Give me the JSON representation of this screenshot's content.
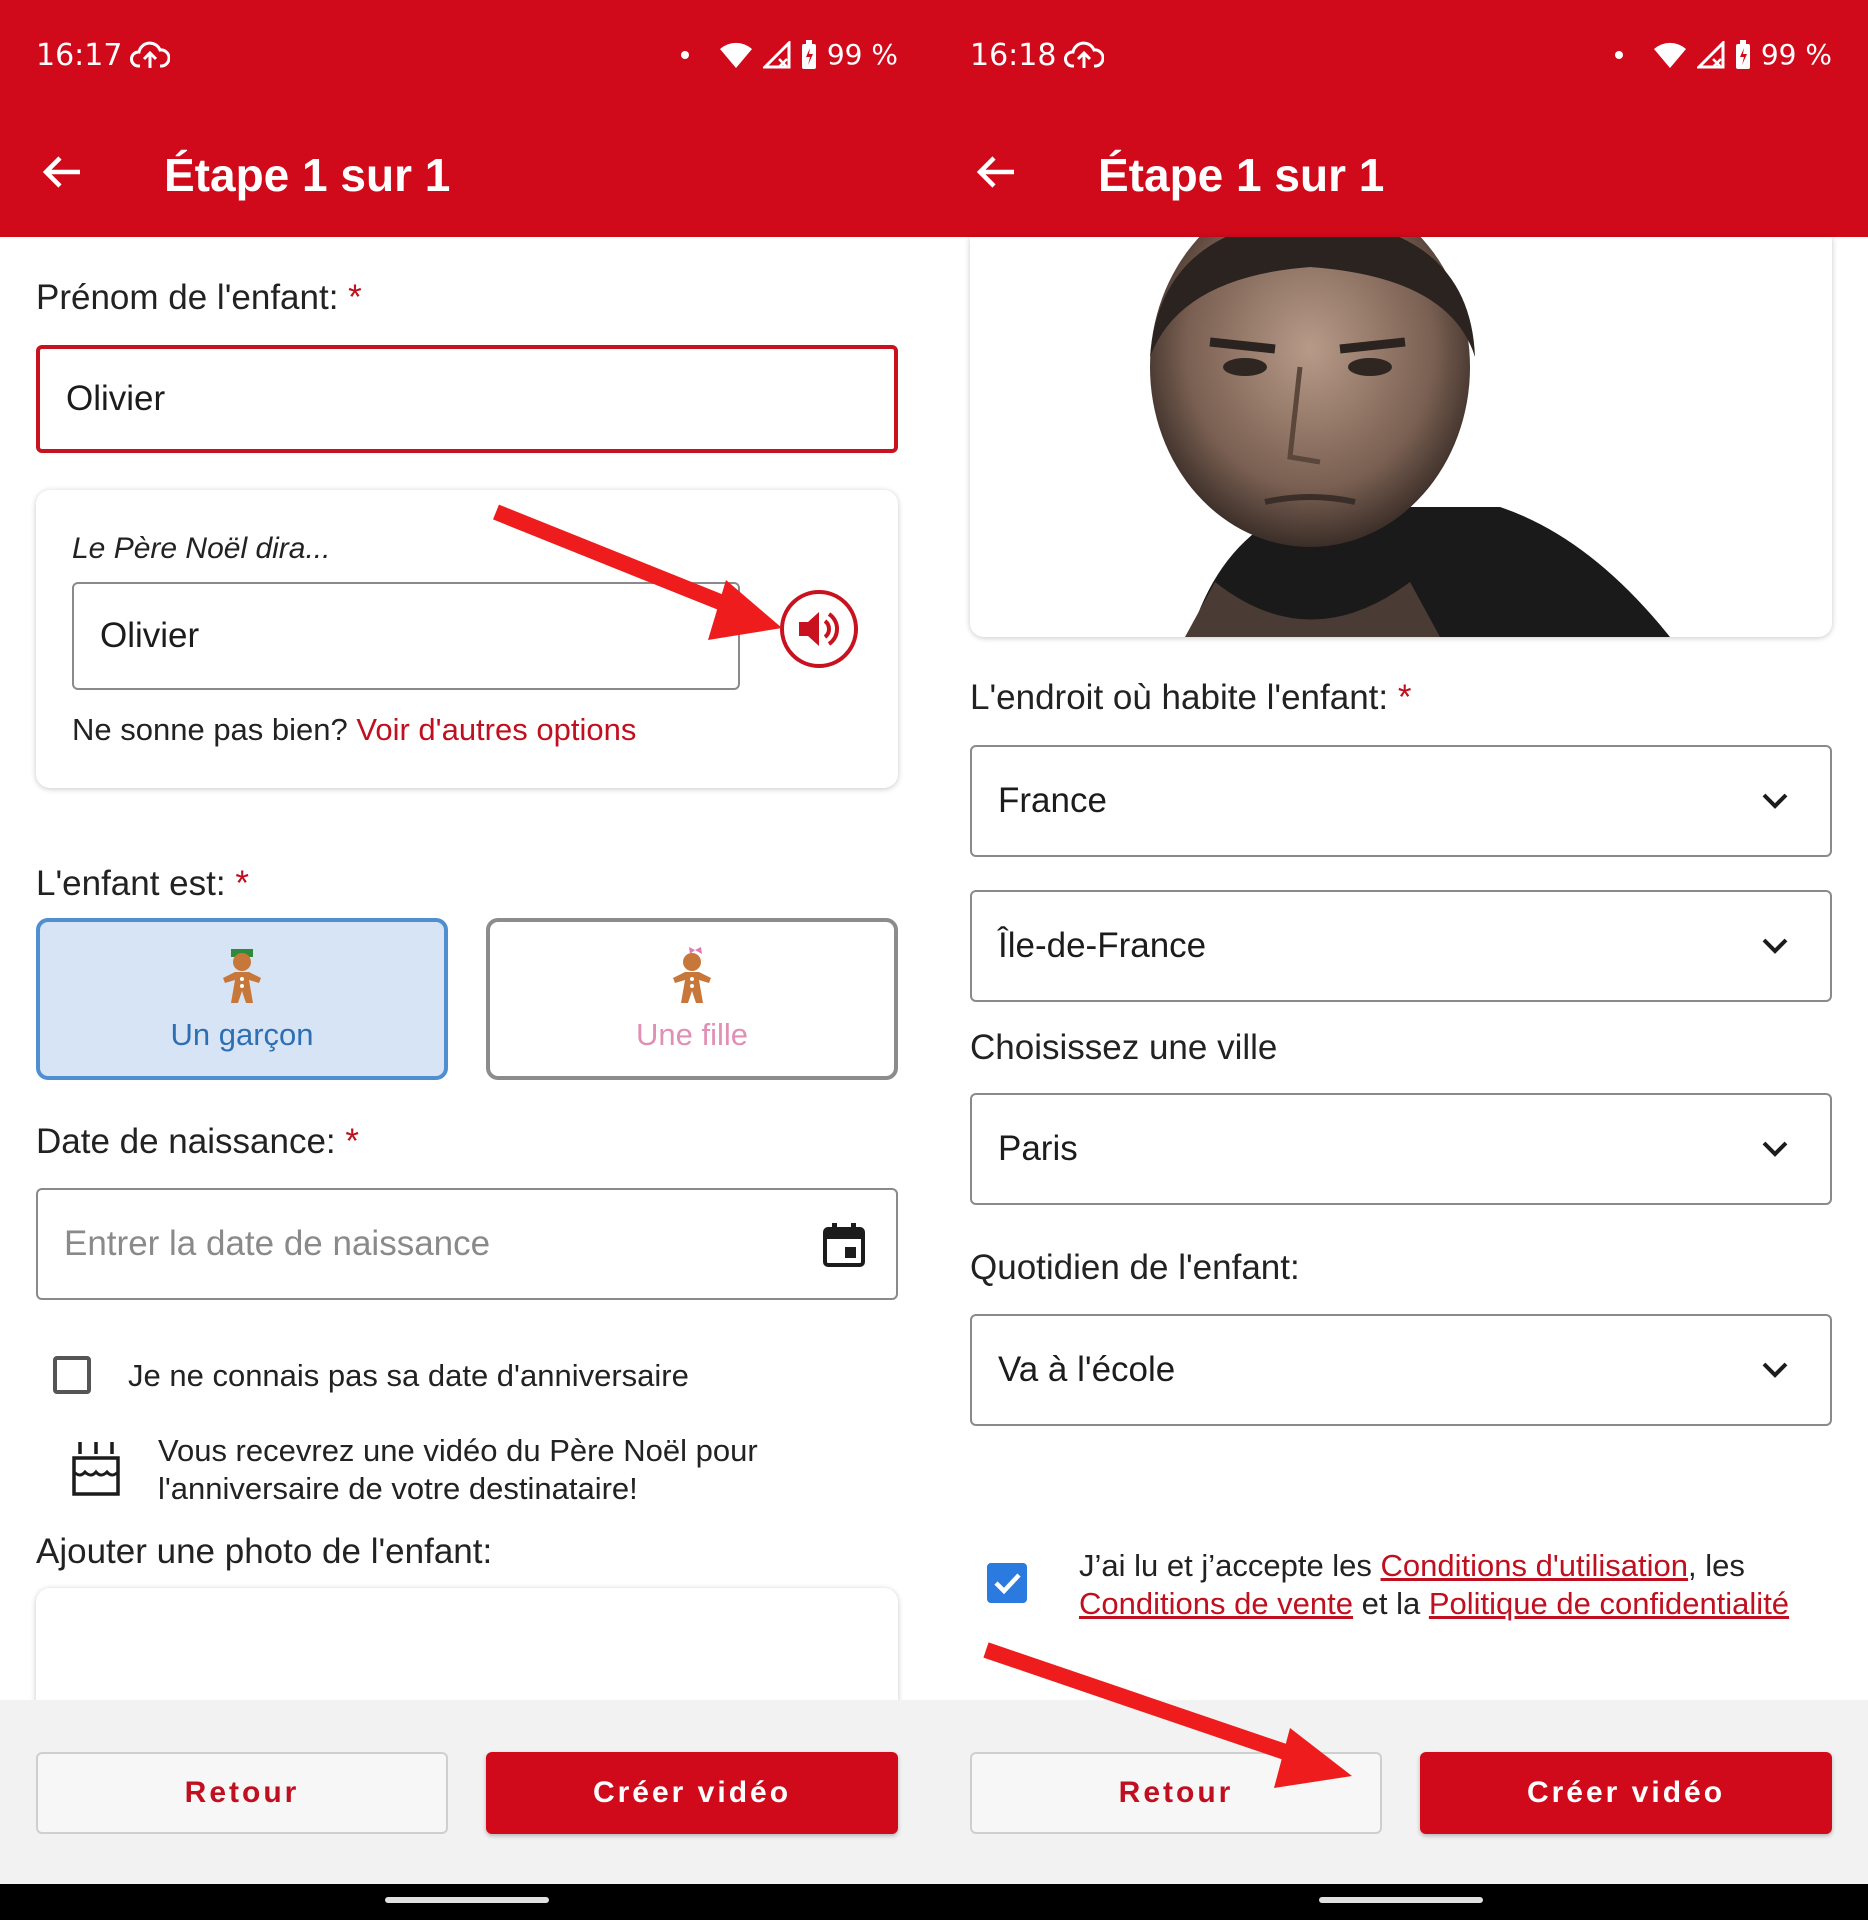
{
  "status_left": {
    "time": "16:17",
    "battery": "99 %"
  },
  "status_right": {
    "time": "16:18",
    "battery": "99 %"
  },
  "header": {
    "title": "Étape 1 sur 1"
  },
  "left": {
    "first_name_label": "Prénom de l'enfant:",
    "required_mark": "*",
    "first_name_value": "Olivier",
    "pronunciation_label": "Le Père Noël dira...",
    "pronunciation_value": "Olivier",
    "hint_text": "Ne sonne pas bien?",
    "hint_link": "Voir d'autres options",
    "gender_label": "L'enfant est:",
    "gender_boy": "Un garçon",
    "gender_girl": "Une fille",
    "birthdate_label": "Date de naissance:",
    "birthdate_placeholder": "Entrer la date de naissance",
    "unknown_birthday": "Je ne connais pas sa date d'anniversaire",
    "birthday_info": "Vous recevrez une vidéo du Père Noël pour l'anniversaire de votre destinataire!",
    "photo_label": "Ajouter une photo de l'enfant:"
  },
  "right": {
    "location_label": "L'endroit où habite l'enfant:",
    "country": "France",
    "region": "Île-de-France",
    "city_label": "Choisissez une ville",
    "city": "Paris",
    "daily_label": "Quotidien de l'enfant:",
    "daily": "Va à l'école",
    "terms_prefix": "J’ai lu et j’accepte les ",
    "terms_link1": "Conditions d'utilisation",
    "terms_mid1": ", les ",
    "terms_link2": "Conditions de vente",
    "terms_mid2": " et la ",
    "terms_link3": "Politique de confidentialité"
  },
  "footer": {
    "back": "Retour",
    "create": "Créer vidéo"
  },
  "colors": {
    "brand_red": "#d10a1b",
    "boy_blue": "#4f8fd0",
    "girl_pink": "#e18fb4",
    "checkbox_blue": "#2a7ae0"
  },
  "icons": [
    "cloud-upload-icon",
    "wifi-icon",
    "signal-icon",
    "battery-icon",
    "back-arrow-icon",
    "speaker-icon",
    "gingerbread-boy-icon",
    "gingerbread-girl-icon",
    "calendar-icon",
    "birthday-cake-icon",
    "chevron-down-icon"
  ]
}
